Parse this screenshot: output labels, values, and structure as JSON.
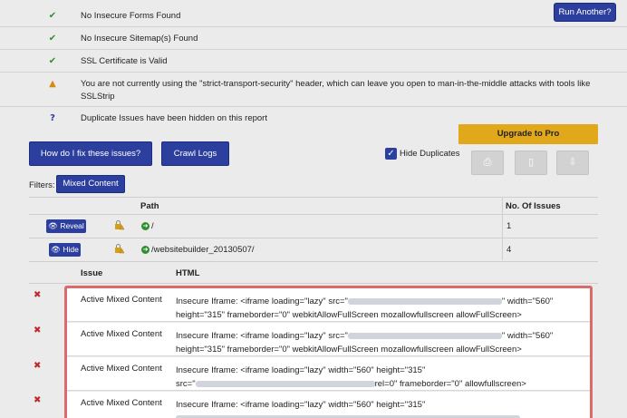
{
  "header": {
    "run_again_label": "Run Another?"
  },
  "checks": [
    {
      "status": "ok",
      "icon": "check-icon",
      "text": "No Insecure Forms Found"
    },
    {
      "status": "ok",
      "icon": "check-icon",
      "text": "No Insecure Sitemap(s) Found"
    },
    {
      "status": "ok",
      "icon": "check-icon",
      "text": "SSL Certificate is Valid"
    },
    {
      "status": "warn",
      "icon": "warning-icon",
      "text": "You are not currently using the \"strict-transport-security\" header, which can leave you open to man-in-the-middle attacks with tools like SSLStrip"
    },
    {
      "status": "info",
      "icon": "question-icon",
      "text": "Duplicate Issues have been hidden on this report"
    }
  ],
  "actions": {
    "fix_issues_label": "How do I fix these issues?",
    "crawl_logs_label": "Crawl Logs",
    "upgrade_label": "Upgrade to Pro",
    "hide_duplicates_label": "Hide Duplicates",
    "hide_duplicates_checked": true
  },
  "filters": {
    "label": "Filters:",
    "active_filter": "Mixed Content"
  },
  "paths_table": {
    "headers": {
      "path": "Path",
      "count": "No. Of Issues"
    },
    "rows": [
      {
        "button": "Reveal",
        "path": "/",
        "count": "1"
      },
      {
        "button": "Hide",
        "path": "/websitebuilder_20130507/",
        "count": "4"
      }
    ]
  },
  "issues_table": {
    "headers": {
      "issue": "Issue",
      "html": "HTML"
    },
    "rows": [
      {
        "type": "Active Mixed Content",
        "line1_prefix": "Insecure Iframe: <iframe loading=\"lazy\" src=\"",
        "line1_suffix": "\" width=\"560\"",
        "line2": "height=\"315\" frameborder=\"0\" webkitAllowFullScreen mozallowfullscreen allowFullScreen>"
      },
      {
        "type": "Active Mixed Content",
        "line1_prefix": "Insecure Iframe: <iframe loading=\"lazy\" src=\"",
        "line1_suffix": "\" width=\"560\"",
        "line2": "height=\"315\" frameborder=\"0\" webkitAllowFullScreen mozallowfullscreen allowFullScreen>"
      },
      {
        "type": "Active Mixed Content",
        "line1_prefix": "Insecure Iframe: <iframe loading=\"lazy\" width=\"560\" height=\"315\"",
        "line1_suffix": "",
        "line2_prefix": "src=\"",
        "line2": "rel=0\" frameborder=\"0\" allowfullscreen>"
      },
      {
        "type": "Active Mixed Content",
        "line1_prefix": "Insecure Iframe: <iframe loading=\"lazy\" width=\"560\" height=\"315\"",
        "line1_suffix": "",
        "line2": ""
      }
    ]
  },
  "colors": {
    "primary_button": "#2d3f9e",
    "upgrade_button": "#e2a81b",
    "highlight_border": "#d86b6b",
    "error_icon": "#c0272d",
    "ok_icon": "#2f8f2f"
  }
}
